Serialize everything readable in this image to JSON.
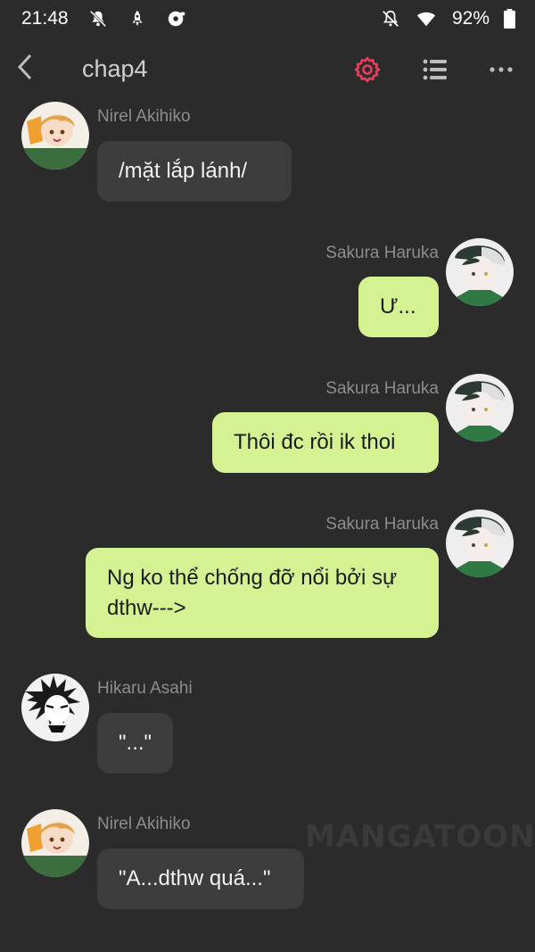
{
  "status_bar": {
    "time": "21:48",
    "battery": "92%",
    "icons": [
      "mute-notification-icon",
      "rocket-icon",
      "media-icon",
      "bell-off-icon",
      "wifi-icon",
      "battery-icon"
    ]
  },
  "app_bar": {
    "title": "chap4",
    "accent_color": "#e8405a"
  },
  "messages": [
    {
      "side": "left",
      "name": "Nirel Akihiko",
      "text": "/mặt lắp lánh/"
    },
    {
      "side": "right",
      "name": "Sakura Haruka",
      "text": "Ư..."
    },
    {
      "side": "right",
      "name": "Sakura Haruka",
      "text": "Thôi đc rồi ik thoi"
    },
    {
      "side": "right",
      "name": "Sakura Haruka",
      "text": "Ng ko thể chống đỡ nổi bởi sự dthw--->"
    },
    {
      "side": "left",
      "name": "Hikaru Asahi",
      "text": "\"...\""
    },
    {
      "side": "left",
      "name": "Nirel Akihiko",
      "text": "\"A...dthw quá...\""
    }
  ],
  "watermark": "MANGATOON",
  "colors": {
    "background": "#2b2b2b",
    "left_bubble": "#3c3c3c",
    "right_bubble": "#d4f292"
  }
}
